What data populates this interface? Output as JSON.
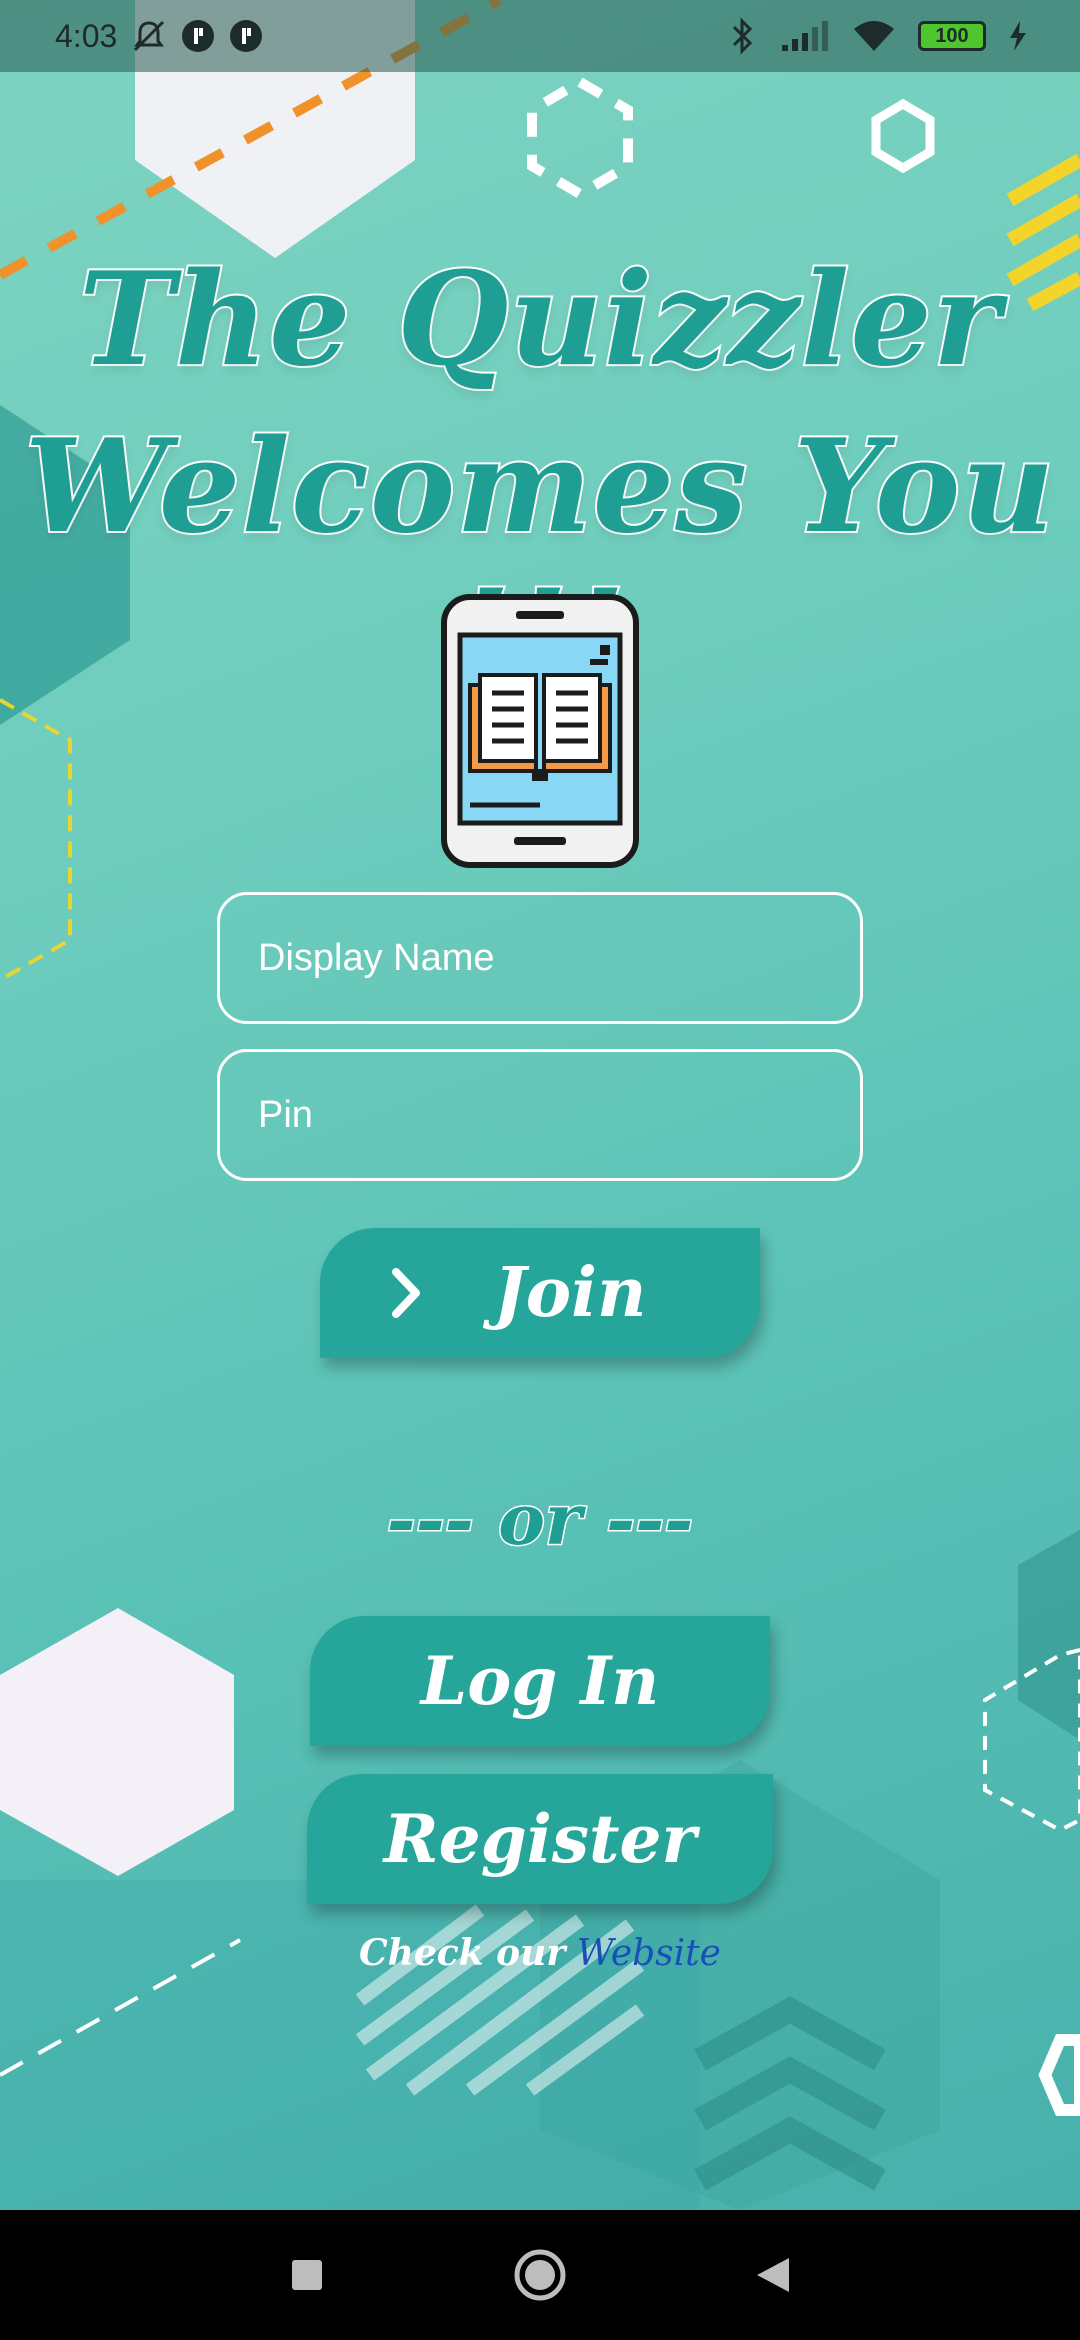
{
  "status_bar": {
    "time": "4:03",
    "icons_left": [
      "mute-bell-icon",
      "notification-icon",
      "notification-icon"
    ],
    "icons_right": [
      "bluetooth-icon",
      "signal-icon",
      "wifi-icon",
      "battery-icon",
      "charging-icon"
    ],
    "battery_level": "100"
  },
  "header": {
    "title_line1": "The Quizzler",
    "title_line2": "Welcomes You !!!"
  },
  "logo": {
    "icon": "phone-book-icon"
  },
  "form": {
    "display_name_placeholder": "Display Name",
    "display_name_value": "",
    "pin_placeholder": "Pin",
    "pin_value": ""
  },
  "actions": {
    "join_label": "Join",
    "join_icon": "chevron-right-icon",
    "or_text": "--- or ---",
    "login_label": "Log In",
    "register_label": "Register"
  },
  "footer": {
    "prefix_text": "Check our",
    "link_text": "Website"
  },
  "nav_bar": {
    "buttons": [
      "recents-square-icon",
      "home-circle-icon",
      "back-triangle-icon"
    ]
  },
  "colors": {
    "accent": "#26a69a",
    "title_fill": "#1f9e94",
    "link": "#1a4fb8",
    "background_top": "#7ed3c1",
    "background_bottom": "#46aeaa"
  }
}
